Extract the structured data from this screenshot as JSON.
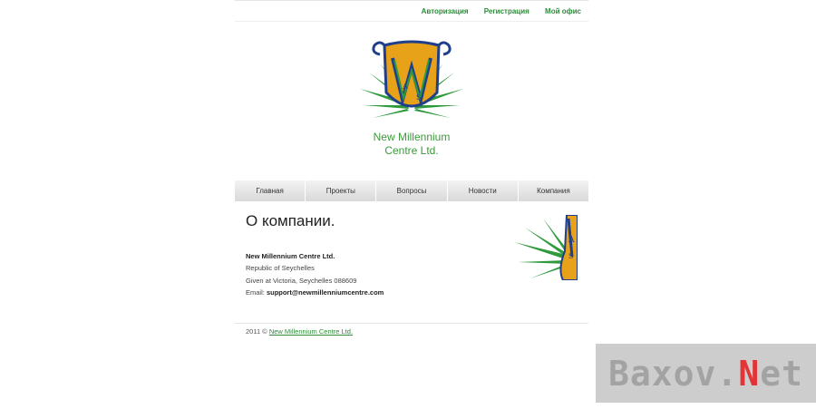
{
  "top_links": [
    "Авторизация",
    "Регистрация",
    "Мой офис"
  ],
  "logo": {
    "line1": "New Millennium",
    "line2": "Centre Ltd."
  },
  "nav": [
    "Главная",
    "Проекты",
    "Вопросы",
    "Новости",
    "Компания"
  ],
  "page_title": "О компании.",
  "company": {
    "name": "New Millennium Centre Ltd.",
    "country": "Republic of Seychelles",
    "address": "Given at Victoria, Seychelles 088609",
    "email_label": "Email:",
    "email": "support@newmillenniumcentre.com"
  },
  "footer": {
    "prefix": "2011 ©",
    "link": "New Millennium Centre  Ltd."
  },
  "watermark": {
    "part1": "Baxov.",
    "part2": "N",
    "part3": "et"
  },
  "colors": {
    "accent": "#2e8b3a",
    "logo_gold": "#e8a21a",
    "logo_blue": "#1f3f8a"
  }
}
